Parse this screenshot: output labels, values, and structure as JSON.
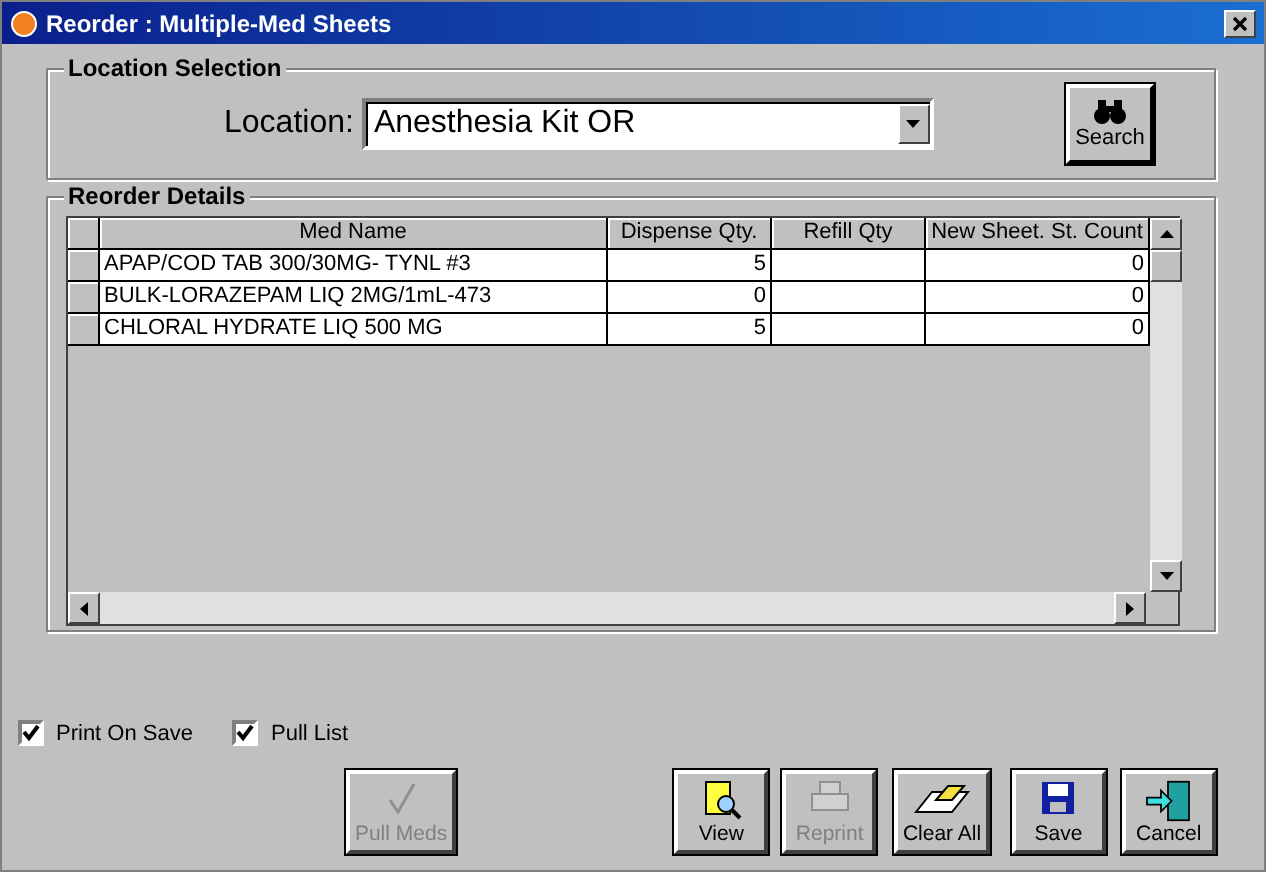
{
  "window": {
    "title": "Reorder : Multiple-Med Sheets"
  },
  "location_selection": {
    "title": "Location Selection",
    "label": "Location:",
    "value": "Anesthesia Kit OR",
    "search_button": "Search"
  },
  "reorder_details": {
    "title": "Reorder Details",
    "columns": [
      "Med Name",
      "Dispense Qty.",
      "Refill Qty",
      "New Sheet. St. Count"
    ],
    "rows": [
      [
        "APAP/COD TAB 300/30MG- TYNL #3",
        "5",
        "",
        "0"
      ],
      [
        "BULK-LORAZEPAM LIQ 2MG/1mL-473",
        "0",
        "",
        "0"
      ],
      [
        "CHLORAL HYDRATE LIQ 500 MG",
        "5",
        "",
        "0"
      ]
    ]
  },
  "options": [
    {
      "label": "Print On Save",
      "checked": true
    },
    {
      "label": "Pull List",
      "checked": true
    }
  ],
  "buttons": [
    {
      "label": "Pull Meds",
      "kind": "pull",
      "disabled": true
    },
    {
      "label": "View",
      "kind": "view",
      "disabled": false
    },
    {
      "label": "Reprint",
      "kind": "print",
      "disabled": true
    },
    {
      "label": "Clear All",
      "kind": "clear",
      "disabled": false
    },
    {
      "label": "Save",
      "kind": "save",
      "disabled": false
    },
    {
      "label": "Cancel",
      "kind": "cancel",
      "disabled": false
    }
  ]
}
